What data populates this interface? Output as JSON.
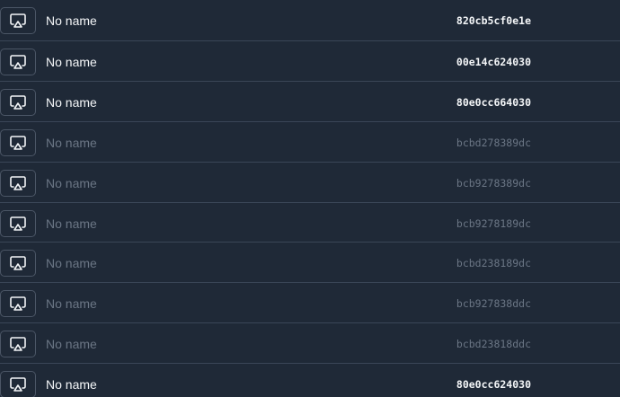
{
  "devices": [
    {
      "name": "No name",
      "id": "820cb5cf0e1e",
      "active": true
    },
    {
      "name": "No name",
      "id": "00e14c624030",
      "active": true
    },
    {
      "name": "No name",
      "id": "80e0cc664030",
      "active": true
    },
    {
      "name": "No name",
      "id": "bcbd278389dc",
      "active": false
    },
    {
      "name": "No name",
      "id": "bcb9278389dc",
      "active": false
    },
    {
      "name": "No name",
      "id": "bcb9278189dc",
      "active": false
    },
    {
      "name": "No name",
      "id": "bcbd238189dc",
      "active": false
    },
    {
      "name": "No name",
      "id": "bcb927838ddc",
      "active": false
    },
    {
      "name": "No name",
      "id": "bcbd23818ddc",
      "active": false
    },
    {
      "name": "No name",
      "id": "80e0cc624030",
      "active": true
    }
  ],
  "icon": "airplay-icon",
  "colors": {
    "background": "#1f2937",
    "divider": "#3a4657",
    "active_text": "#f4f6f8",
    "inactive_text": "#6b7685",
    "icon_border": "#4b5666"
  }
}
